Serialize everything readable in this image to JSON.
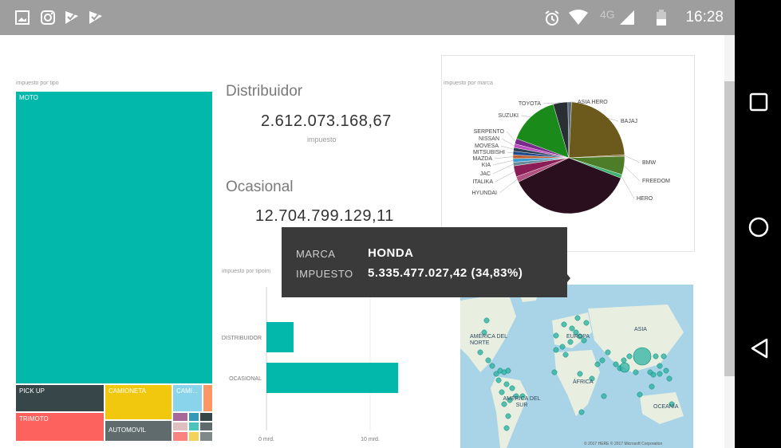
{
  "statusbar": {
    "time": "16:28",
    "network": "4G",
    "left_icons": [
      "gallery-icon",
      "instagram-icon",
      "check-flag-icon",
      "check-flag-icon"
    ],
    "right_icons": [
      "alarm-icon",
      "wifi-icon",
      "signal-icon",
      "battery-icon"
    ]
  },
  "navbar": {
    "icons": [
      "recents-icon",
      "home-icon",
      "back-icon"
    ]
  },
  "treemap": {
    "title": "impuesto por tipo",
    "tiles": [
      {
        "label": "MOTO",
        "color": "#01b8aa"
      },
      {
        "label": "PICK UP",
        "color": "#374649"
      },
      {
        "label": "CAMIONETA",
        "color": "#f2c80f"
      },
      {
        "label": "CAMI...",
        "color": "#8ad4eb"
      },
      {
        "label": "TRIMOTO",
        "color": "#fd625e"
      },
      {
        "label": "AUTOMOVIL",
        "color": "#5f6b6d"
      }
    ]
  },
  "kpis": [
    {
      "heading": "Distribuidor",
      "value": "2.612.073.168,67",
      "sub": "impuesto"
    },
    {
      "heading": "Ocasional",
      "value": "12.704.799.129,11",
      "sub": ""
    }
  ],
  "barchart": {
    "title": "impuesto por tipoim"
  },
  "piechart": {
    "title": "impuesto por marca"
  },
  "map": {
    "labels": [
      "AMÉRICA DEL NORTE",
      "EUROPA",
      "ASIA",
      "ÁFRICA",
      "AMÉRICA DEL SUR",
      "OCEANÍA"
    ],
    "footer": "© 2017 HERE   © 2017 Microsoft Corporation"
  },
  "tooltip": {
    "key1": "MARCA",
    "val1": "HONDA",
    "key2": "IMPUESTO",
    "val2": "5.335.477.027,42 (34,83%)"
  },
  "chart_data": [
    {
      "type": "bar",
      "title": "impuesto por tipoim",
      "orientation": "horizontal",
      "categories": [
        "DISTRIBUIDOR",
        "OCASIONAL"
      ],
      "values": [
        2.612,
        12.705
      ],
      "unit": "mrd.",
      "xticks": [
        "0 mrd.",
        "10 mrd."
      ],
      "xlim": [
        0,
        15
      ],
      "color": "#01b8aa"
    },
    {
      "type": "pie",
      "title": "impuesto por marca",
      "slices": [
        {
          "label": "BAJAJ",
          "value": 22.0,
          "color": "#6b5a1b"
        },
        {
          "label": "BMW",
          "value": 0.4,
          "color": "#8a7a3a"
        },
        {
          "label": "FREEDOM",
          "value": 5.0,
          "color": "#4e7d2a"
        },
        {
          "label": "HERO",
          "value": 1.0,
          "color": "#3cb371"
        },
        {
          "label": "HONDA",
          "value": 34.83,
          "color": "#2a0f1e"
        },
        {
          "label": "HYUNDAI",
          "value": 1.5,
          "color": "#b05080"
        },
        {
          "label": "ITALIKA",
          "value": 3.0,
          "color": "#8a1d55"
        },
        {
          "label": "JAC",
          "value": 1.0,
          "color": "#6a8a9a"
        },
        {
          "label": "KIA",
          "value": 1.0,
          "color": "#3a9bd0"
        },
        {
          "label": "MAZDA",
          "value": 1.0,
          "color": "#c06030"
        },
        {
          "label": "MITSUBISHI",
          "value": 1.0,
          "color": "#1e4a8a"
        },
        {
          "label": "MOVESA",
          "value": 1.0,
          "color": "#2c3e50"
        },
        {
          "label": "NISSAN",
          "value": 1.0,
          "color": "#c050c0"
        },
        {
          "label": "SERPENTO",
          "value": 1.5,
          "color": "#7a2a8a"
        },
        {
          "label": "SUZUKI",
          "value": 14.0,
          "color": "#1a8a1a"
        },
        {
          "label": "TOYOTA",
          "value": 4.0,
          "color": "#2a2f33"
        },
        {
          "label": "ASIA HERO",
          "value": 1.0,
          "color": "#5a6a7a"
        }
      ]
    }
  ]
}
